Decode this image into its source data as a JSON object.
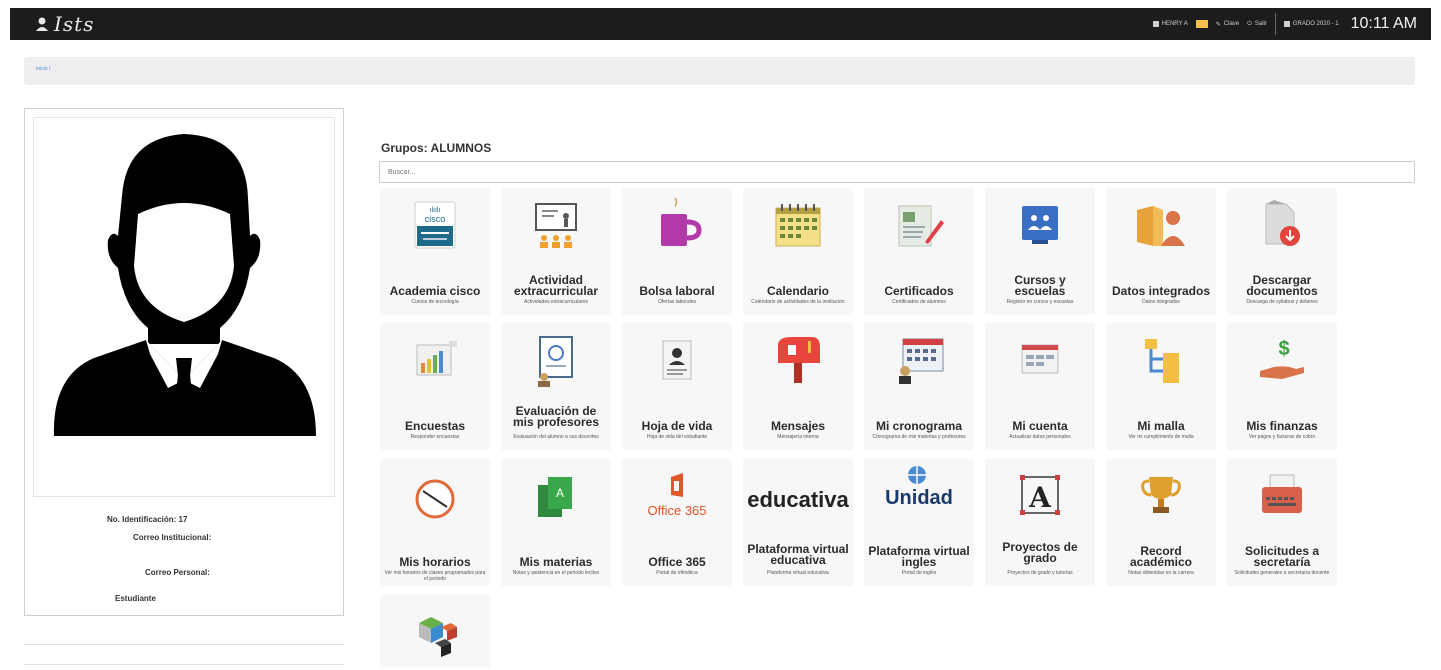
{
  "header": {
    "logo_text": "Ists",
    "user_label": "HENRY A",
    "clave_label": "Clave",
    "salir_label": "Salir",
    "grado_label": "GRADO 2020 - 1",
    "time": "10:11 AM"
  },
  "breadcrumb": "Inicio /",
  "profile": {
    "id_label": "No. Identificación: 17",
    "correo_institucional_label": "Correo Institucional:",
    "correo_personal_label": "Correo Personal:",
    "role": "Estudiante"
  },
  "group_title": "Grupos: ALUMNOS",
  "search": {
    "placeholder": "Buscar..."
  },
  "apps": [
    {
      "title": "Academia cisco",
      "desc": "Cursos de tecnología",
      "icon": "cisco-icon"
    },
    {
      "title": "Actividad extracurricular",
      "desc": "Actividades extracurriculares",
      "icon": "presentation-icon"
    },
    {
      "title": "Bolsa laboral",
      "desc": "Ofertas laborales",
      "icon": "mug-icon"
    },
    {
      "title": "Calendario",
      "desc": "Calendario de actividades de la institución",
      "icon": "calendar-icon"
    },
    {
      "title": "Certificados",
      "desc": "Certificados de alumnos",
      "icon": "certificate-icon"
    },
    {
      "title": "Cursos y escuelas",
      "desc": "Registro en cursos y escuelas",
      "icon": "courses-icon"
    },
    {
      "title": "Datos integrados",
      "desc": "Datos integrados",
      "icon": "folder-user-icon"
    },
    {
      "title": "Descargar documentos",
      "desc": "Descarga de syllabus y deberes",
      "icon": "download-document-icon"
    },
    {
      "title": "Encuestas",
      "desc": "Responder encuestas",
      "icon": "survey-chart-icon"
    },
    {
      "title": "Evaluación de mis profesores",
      "desc": "Evaluación del alumno a sus docentes",
      "icon": "evaluation-icon"
    },
    {
      "title": "Hoja de vida",
      "desc": "Hoja de vida del estudiante",
      "icon": "resume-icon"
    },
    {
      "title": "Mensajes",
      "desc": "Mensajería interna",
      "icon": "mailbox-icon"
    },
    {
      "title": "Mi cronograma",
      "desc": "Cronograma de mis materias y profesores",
      "icon": "schedule-icon"
    },
    {
      "title": "Mi cuenta",
      "desc": "Actualizar datos personales",
      "icon": "account-icon"
    },
    {
      "title": "Mi malla",
      "desc": "Ver mi cumplimiento de malla",
      "icon": "curriculum-icon"
    },
    {
      "title": "Mis finanzas",
      "desc": "Ver pagos y facturas de cobro",
      "icon": "finance-icon"
    },
    {
      "title": "Mis horarios",
      "desc": "Ver mis horarios de clases programados para el periodo",
      "icon": "clock-icon"
    },
    {
      "title": "Mis materias",
      "desc": "Notas y asistencia en el periodo lectivo",
      "icon": "books-icon"
    },
    {
      "title": "Office 365",
      "desc": "Portal de ofimática",
      "icon": "office365-icon",
      "logo_text": "Office 365"
    },
    {
      "title": "Plataforma virtual educativa",
      "desc": "Plataforma virtual educativa",
      "icon": "educativa-icon",
      "logo_text": "educativa"
    },
    {
      "title": "Plataforma virtual ingles",
      "desc": "Portal de inglés",
      "icon": "unidad-icon",
      "logo_text": "Unidad"
    },
    {
      "title": "Proyectos de grado",
      "desc": "Proyectos de grado y tutorías",
      "icon": "project-icon"
    },
    {
      "title": "Record académico",
      "desc": "Notas obtenidas en la carrera",
      "icon": "trophy-icon"
    },
    {
      "title": "Solicitudes a secretaría",
      "desc": "Solicitudes generales a secretaría docente",
      "icon": "typewriter-icon"
    },
    {
      "title": "",
      "desc": "",
      "icon": "cubes-icon"
    }
  ],
  "colors": {
    "topbar": "#1c1c1c",
    "cisco": "#1e6a8a",
    "mug": "#b23aa8",
    "mailbox": "#e8453c",
    "office": "#e0552a",
    "educativa": "#c8202f",
    "trophy": "#c77d1a"
  }
}
